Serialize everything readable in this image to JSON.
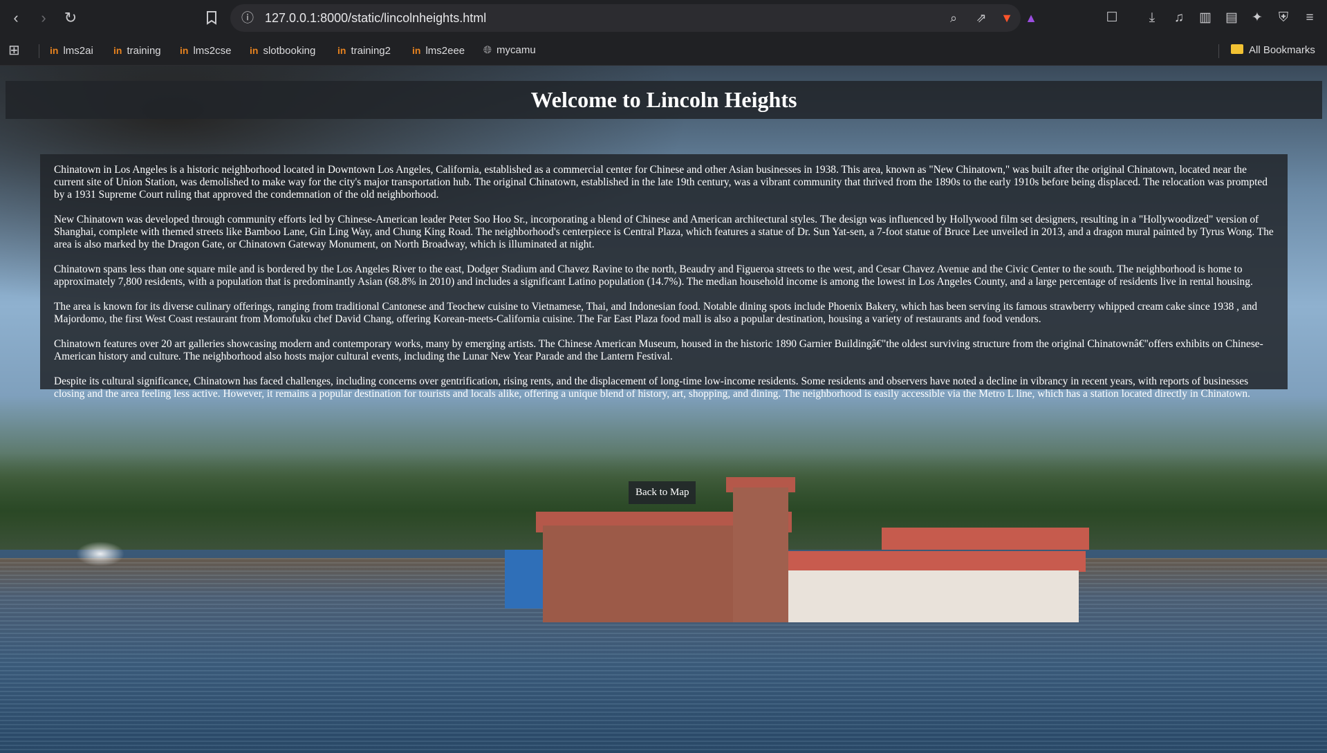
{
  "browser": {
    "url": "127.0.0.1:8000/static/lincolnheights.html",
    "bookmarks": [
      {
        "label": "lms2ai"
      },
      {
        "label": "training"
      },
      {
        "label": "lms2cse"
      },
      {
        "label": "slotbooking"
      },
      {
        "label": "training2"
      },
      {
        "label": "lms2eee"
      },
      {
        "label": "mycamu"
      }
    ],
    "all_bookmarks_label": "All Bookmarks"
  },
  "page": {
    "title": "Welcome to Lincoln Heights",
    "paragraphs": [
      "Chinatown in Los Angeles is a historic neighborhood located in Downtown Los Angeles, California, established as a commercial center for Chinese and other Asian businesses in 1938. This area, known as \"New Chinatown,\" was built after the original Chinatown, located near the current site of Union Station, was demolished to make way for the city's major transportation hub. The original Chinatown, established in the late 19th century, was a vibrant community that thrived from the 1890s to the early 1910s before being displaced. The relocation was prompted by a 1931 Supreme Court ruling that approved the condemnation of the old neighborhood.",
      "New Chinatown was developed through community efforts led by Chinese-American leader Peter Soo Hoo Sr., incorporating a blend of Chinese and American architectural styles. The design was influenced by Hollywood film set designers, resulting in a \"Hollywoodized\" version of Shanghai, complete with themed streets like Bamboo Lane, Gin Ling Way, and Chung King Road. The neighborhood's centerpiece is Central Plaza, which features a statue of Dr. Sun Yat-sen, a 7-foot statue of Bruce Lee unveiled in 2013, and a dragon mural painted by Tyrus Wong. The area is also marked by the Dragon Gate, or Chinatown Gateway Monument, on North Broadway, which is illuminated at night.",
      "Chinatown spans less than one square mile and is bordered by the Los Angeles River to the east, Dodger Stadium and Chavez Ravine to the north, Beaudry and Figueroa streets to the west, and Cesar Chavez Avenue and the Civic Center to the south. The neighborhood is home to approximately 7,800 residents, with a population that is predominantly Asian (68.8% in 2010) and includes a significant Latino population (14.7%). The median household income is among the lowest in Los Angeles County, and a large percentage of residents live in rental housing.",
      "The area is known for its diverse culinary offerings, ranging from traditional Cantonese and Teochew cuisine to Vietnamese, Thai, and Indonesian food. Notable dining spots include Phoenix Bakery, which has been serving its famous strawberry whipped cream cake since 1938 , and Majordomo, the first West Coast restaurant from Momofuku chef David Chang, offering Korean-meets-California cuisine. The Far East Plaza food mall is also a popular destination, housing a variety of restaurants and food vendors.",
      "Chinatown features over 20 art galleries showcasing modern and contemporary works, many by emerging artists. The Chinese American Museum, housed in the historic 1890 Garnier Buildingâ€\"the oldest surviving structure from the original Chinatownâ€\"offers exhibits on Chinese-American history and culture. The neighborhood also hosts major cultural events, including the Lunar New Year Parade and the Lantern Festival.",
      "Despite its cultural significance, Chinatown has faced challenges, including concerns over gentrification, rising rents, and the displacement of long-time low-income residents. Some residents and observers have noted a decline in vibrancy in recent years, with reports of businesses closing and the area feeling less active. However, it remains a popular destination for tourists and locals alike, offering a unique blend of history, art, shopping, and dining. The neighborhood is easily accessible via the Metro L line, which has a station located directly in Chinatown."
    ],
    "back_button_label": "Back to Map"
  },
  "icons": [
    "back-icon",
    "forward-icon",
    "reload-icon",
    "bookmark-icon",
    "site-info-icon",
    "zoom-icon",
    "share-icon",
    "brave-shields-icon",
    "brave-rewards-icon",
    "screenshot-icon",
    "download-icon",
    "media-icon",
    "sidebar-icon",
    "wallet-icon",
    "leo-ai-icon",
    "vpn-icon",
    "menu-icon",
    "apps-grid-icon",
    "folder-icon"
  ],
  "colors": {
    "chrome_bg": "#202124",
    "panel_bg": "rgba(33,37,41,0.85)",
    "bookmark_icon": "#e8831f",
    "brave_orange": "#fb542b"
  }
}
